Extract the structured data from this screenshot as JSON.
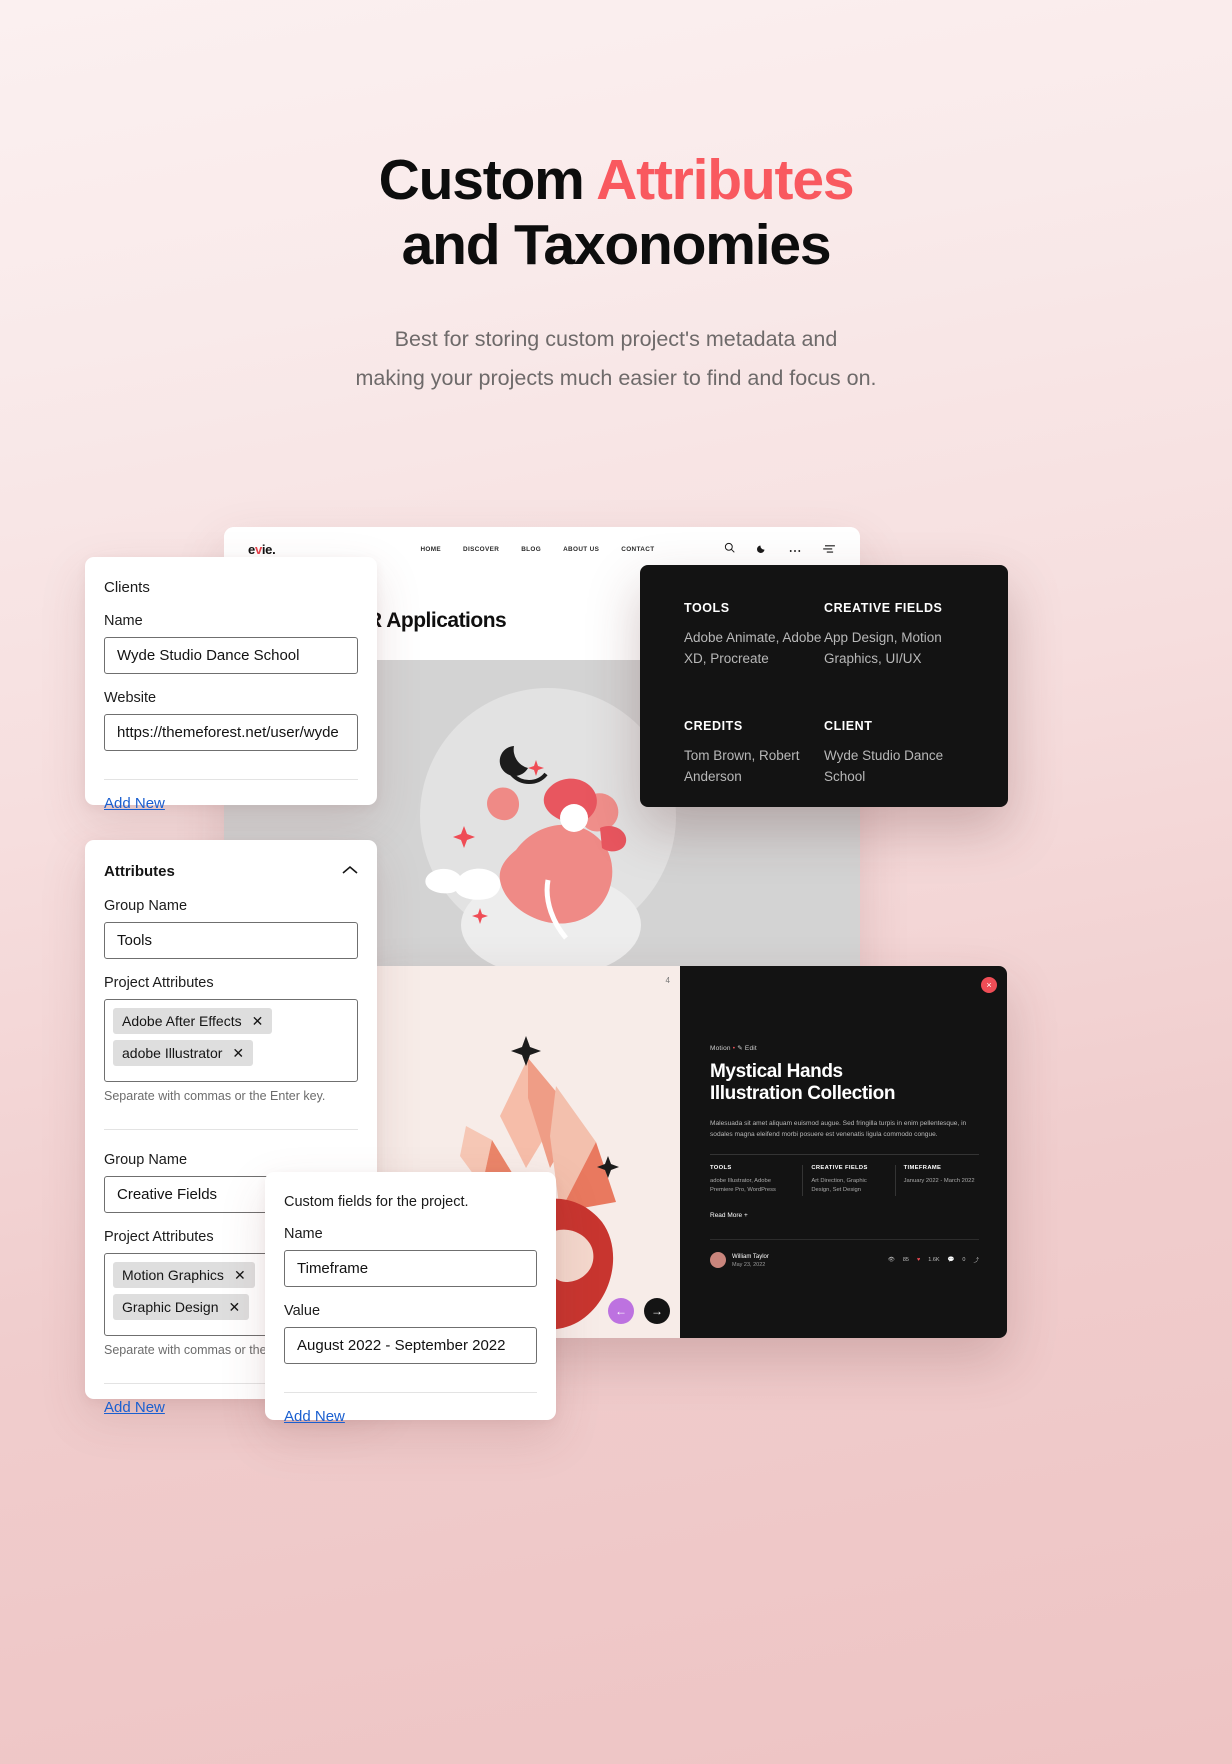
{
  "hero": {
    "title_part1": "Custom ",
    "title_accent": "Attributes",
    "title_part2": "and Taxonomies",
    "subtitle_line1": "Best for storing custom project's metadata and",
    "subtitle_line2": "making your projects much easier to find and focus on.",
    "accent_color": "#f9595f"
  },
  "browser": {
    "brand_pre": "e",
    "brand_accent": "v",
    "brand_post": "ie.",
    "nav": [
      "HOME",
      "DISCOVER",
      "BLOG",
      "ABOUT US",
      "CONTACT"
    ],
    "icons": [
      "search-icon",
      "moon-icon",
      "more-icon",
      "filter-icon"
    ],
    "headline": "n for VR Applications"
  },
  "meta_panel": {
    "blocks": [
      {
        "heading": "TOOLS",
        "value": "Adobe Animate, Adobe XD, Procreate"
      },
      {
        "heading": "CREATIVE FIELDS",
        "value": "App Design, Motion Graphics, UI/UX"
      },
      {
        "heading": "CREDITS",
        "value": "Tom Brown, Robert Anderson"
      },
      {
        "heading": "CLIENT",
        "value": "Wyde Studio Dance School"
      }
    ]
  },
  "clients_card": {
    "title": "Clients",
    "name_label": "Name",
    "name_value": "Wyde Studio Dance School",
    "website_label": "Website",
    "website_value": "https://themeforest.net/user/wyde",
    "add_new": "Add New"
  },
  "attributes_card": {
    "title": "Attributes",
    "collapse_icon": "chevron-up-icon",
    "groups": [
      {
        "group_label": "Group Name",
        "group_value": "Tools",
        "attributes_label": "Project Attributes",
        "tags": [
          "Adobe After Effects",
          "adobe Illustrator"
        ],
        "hint": "Separate with commas or the Enter key."
      },
      {
        "group_label": "Group Name",
        "group_value": "Creative Fields",
        "attributes_label": "Project Attributes",
        "tags": [
          "Motion Graphics",
          "Graphic Design"
        ],
        "hint": "Separate with commas or the Enter key."
      }
    ],
    "add_new": "Add New"
  },
  "custom_fields_card": {
    "title": "Custom fields for the project.",
    "name_label": "Name",
    "name_value": "Timeframe",
    "value_label": "Value",
    "value_value": "August 2022 - September 2022",
    "add_new": "Add New"
  },
  "portfolio": {
    "page_number": "4",
    "close_icon": "close-icon",
    "breadcrumb_category": "Motion",
    "breadcrumb_sep": "•",
    "breadcrumb_action": "Edit",
    "title_line1": "Mystical Hands",
    "title_line2": "Illustration Collection",
    "description": "Malesuada sit amet aliquam euismod augue. Sed fringilla turpis in enim pellentesque, in sodales magna eleifend morbi posuere est venenatis ligula commodo congue.",
    "meta": [
      {
        "heading": "TOOLS",
        "value": "adobe Illustrator, Adobe Premiere Pro, WordPress"
      },
      {
        "heading": "CREATIVE FIELDS",
        "value": "Art Direction, Graphic Design, Set Design"
      },
      {
        "heading": "TIMEFRAME",
        "value": "January 2022 - March 2022"
      }
    ],
    "read_more": "Read More",
    "author_name": "William Taylor",
    "author_date": "May 23, 2022",
    "stats": [
      "85",
      "1.6K",
      "0"
    ],
    "prev_icon": "arrow-left-icon",
    "next_icon": "arrow-right-icon"
  }
}
